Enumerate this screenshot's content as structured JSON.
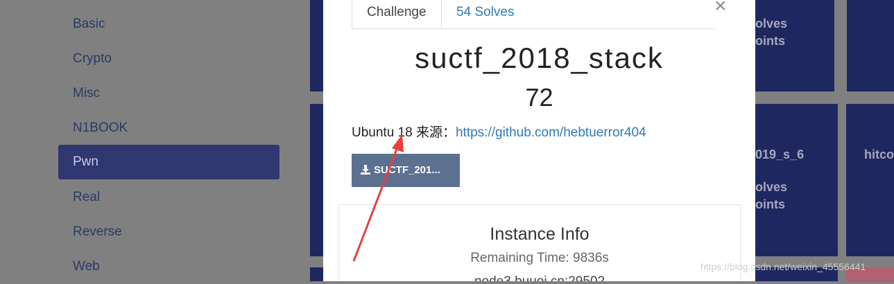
{
  "sidebar": {
    "items": [
      {
        "label": "Basic",
        "active": false
      },
      {
        "label": "Crypto",
        "active": false
      },
      {
        "label": "Misc",
        "active": false
      },
      {
        "label": "N1BOOK",
        "active": false
      },
      {
        "label": "Pwn",
        "active": true
      },
      {
        "label": "Real",
        "active": false
      },
      {
        "label": "Reverse",
        "active": false
      },
      {
        "label": "Web",
        "active": false
      }
    ]
  },
  "background_tiles": {
    "tile1_line1": "olves",
    "tile1_line2": "oints",
    "tile2_title": "019_s_6",
    "tile2_line1": "olves",
    "tile2_line2": "oints",
    "tile3_title": "hitco"
  },
  "modal": {
    "tab_challenge": "Challenge",
    "tab_solves": "54 Solves",
    "close_symbol": "×",
    "title": "suctf_2018_stack",
    "value": "72",
    "description_prefix": "Ubuntu 18 来源：",
    "description_link": "https://github.com/hebtuerror404",
    "download_label": "SUCTF_201...",
    "instance": {
      "title": "Instance Info",
      "remaining_time": "Remaining Time: 9836s",
      "partial_line": "node3.buuoj.cn:29502"
    }
  },
  "watermark": "https://blog.csdn.net/weixin_45556441",
  "colors": {
    "overlay": "#808080",
    "active_category": "#2e3770",
    "tile": "#1f2760",
    "link": "#2f7ab8",
    "download_button": "#5c7090",
    "arrow": "#e8403a"
  }
}
